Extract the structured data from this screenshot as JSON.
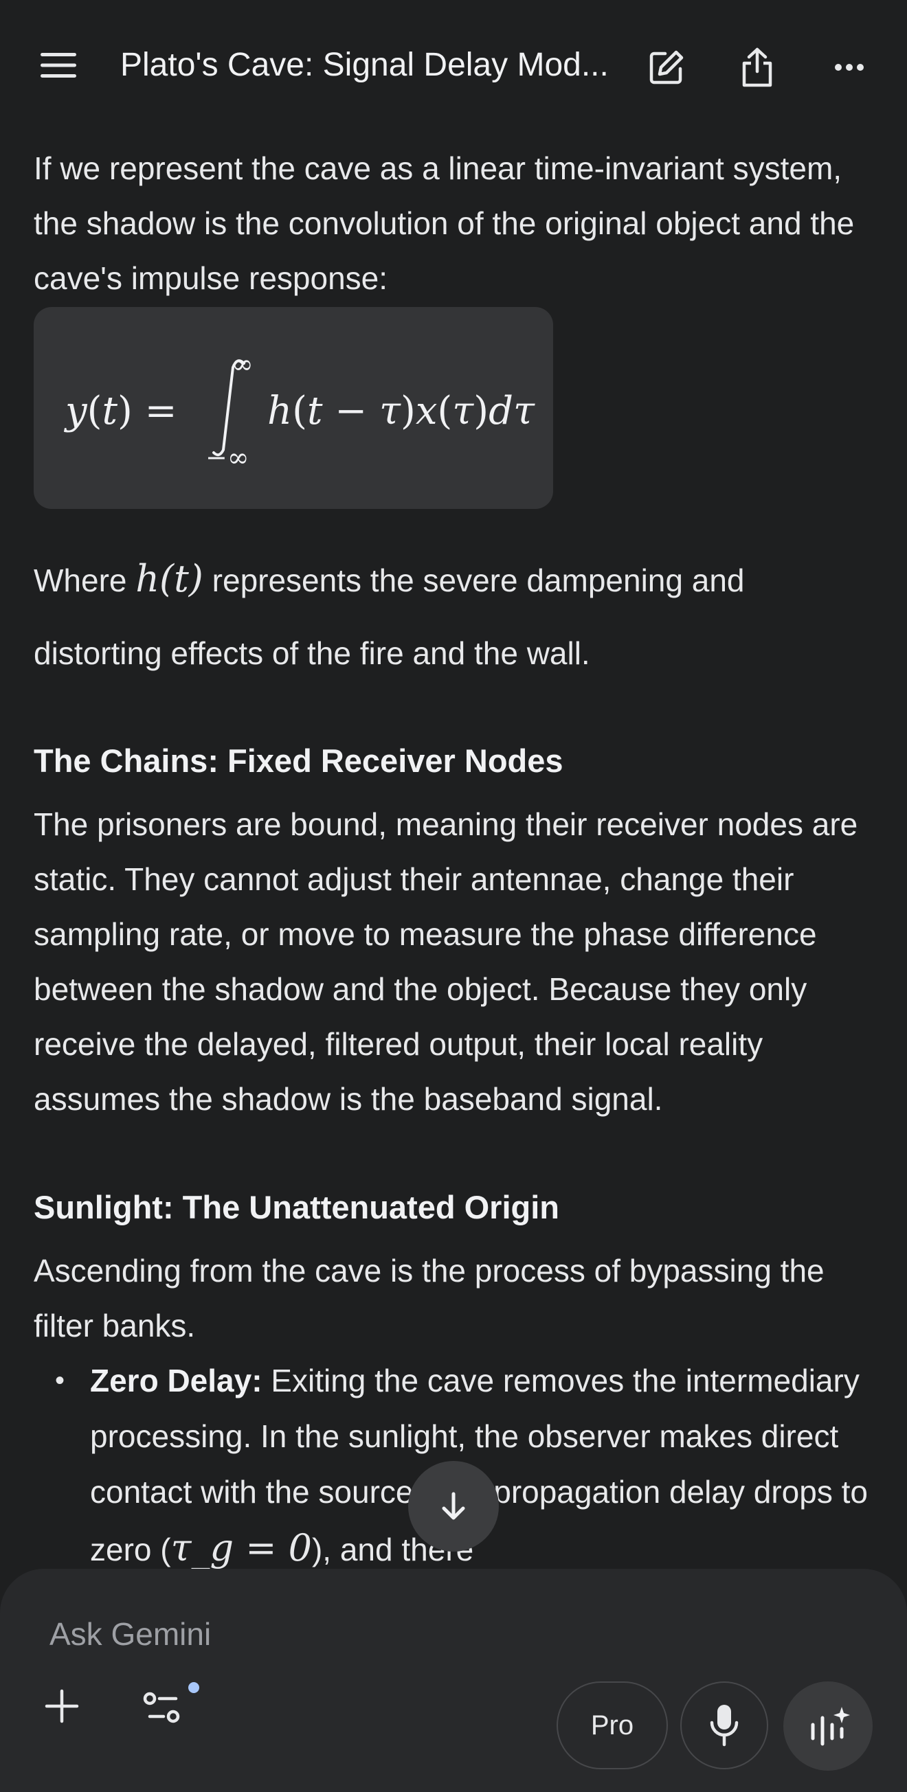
{
  "header": {
    "title": "Plato's Cave: Signal Delay Mod..."
  },
  "content": {
    "intro_paragraph": "If we represent the cave as a linear time-invariant system, the shadow is the convolution of the original object and the cave's impulse response:",
    "equation": "y(t) = ∫_{−∞}^{∞} h(t − τ)x(τ)dτ",
    "where_prefix": "Where ",
    "where_math": "h(t)",
    "where_suffix": " represents the severe dampening and distorting effects of the fire and the wall.",
    "section_chains": {
      "heading": "The Chains: Fixed Receiver Nodes",
      "body": "The prisoners are bound, meaning their receiver nodes are static. They cannot adjust their antennae, change their sampling rate, or move to measure the phase difference between the shadow and the object. Because they only receive the delayed, filtered output, their local reality assumes the shadow is the baseband signal."
    },
    "section_sunlight": {
      "heading": "Sunlight: The Unattenuated Origin",
      "body": "Ascending from the cave is the process of bypassing the filter banks.",
      "bullets": [
        {
          "term": "Zero Delay:",
          "text": " Exiting the cave removes the intermediary processing. In the sunlight, the observer makes direct contact with the source. The propagation delay drops to zero (",
          "math": "τ_g = 0",
          "tail": "), and there"
        }
      ]
    }
  },
  "composer": {
    "placeholder": "Ask Gemini",
    "pro_label": "Pro"
  },
  "icons": {
    "menu": "hamburger-menu-icon",
    "edit": "edit-pencil-icon",
    "share": "share-upload-icon",
    "more": "more-horizontal-icon",
    "scroll": "arrow-down-icon",
    "plus": "plus-icon",
    "tools": "tools-sliders-icon",
    "mic": "microphone-icon",
    "live": "live-sparkle-icon"
  },
  "colors": {
    "background": "#1e1f20",
    "composer": "#28292b",
    "math_block": "#343537",
    "accent_dot": "#a8c7fa"
  }
}
